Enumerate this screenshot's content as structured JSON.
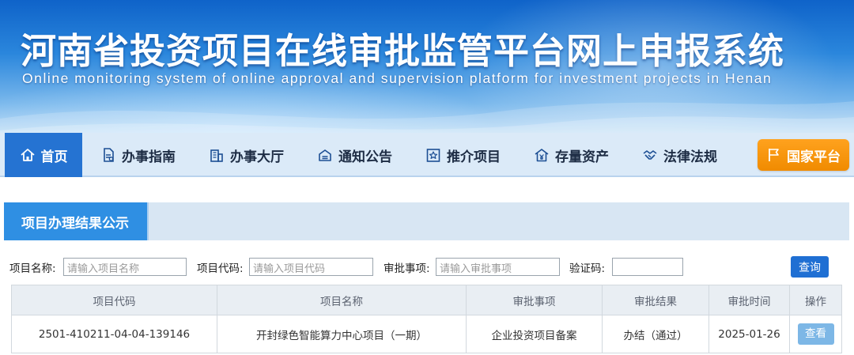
{
  "header": {
    "title": "河南省投资项目在线审批监管平台网上申报系统",
    "subtitle": "Online monitoring system of online approval and supervision platform for investment projects in Henan"
  },
  "nav": {
    "items": [
      {
        "label": "首页",
        "icon": "home-icon"
      },
      {
        "label": "办事指南",
        "icon": "document-icon"
      },
      {
        "label": "办事大厅",
        "icon": "building-icon"
      },
      {
        "label": "通知公告",
        "icon": "announcement-icon"
      },
      {
        "label": "推介项目",
        "icon": "star-icon"
      },
      {
        "label": "存量资产",
        "icon": "yuan-house-icon"
      },
      {
        "label": "法律法规",
        "icon": "handshake-icon"
      }
    ],
    "country_platform": {
      "label": "国家平台",
      "icon": "flag-icon"
    }
  },
  "panel": {
    "title": "项目办理结果公示"
  },
  "search": {
    "project_name_label": "项目名称:",
    "project_name_placeholder": "请输入项目名称",
    "project_code_label": "项目代码:",
    "project_code_placeholder": "请输入项目代码",
    "approval_item_label": "审批事项:",
    "approval_item_placeholder": "请输入审批事项",
    "captcha_label": "验证码:",
    "captcha_value": "",
    "query_button": "查询"
  },
  "table": {
    "headers": [
      "项目代码",
      "项目名称",
      "审批事项",
      "审批结果",
      "审批时间",
      "操作"
    ],
    "rows": [
      {
        "code": "2501-410211-04-04-139146",
        "name": "开封绿色智能算力中心项目（一期）",
        "item": "企业投资项目备案",
        "result": "办结（通过）",
        "date": "2025-01-26",
        "action": "查看"
      }
    ]
  },
  "colors": {
    "nav_active": "#2573d2",
    "country_button": "#f39200",
    "panel_tab": "#2f8fe3",
    "query_button": "#1f6fd3",
    "view_button": "#7db7e6"
  }
}
